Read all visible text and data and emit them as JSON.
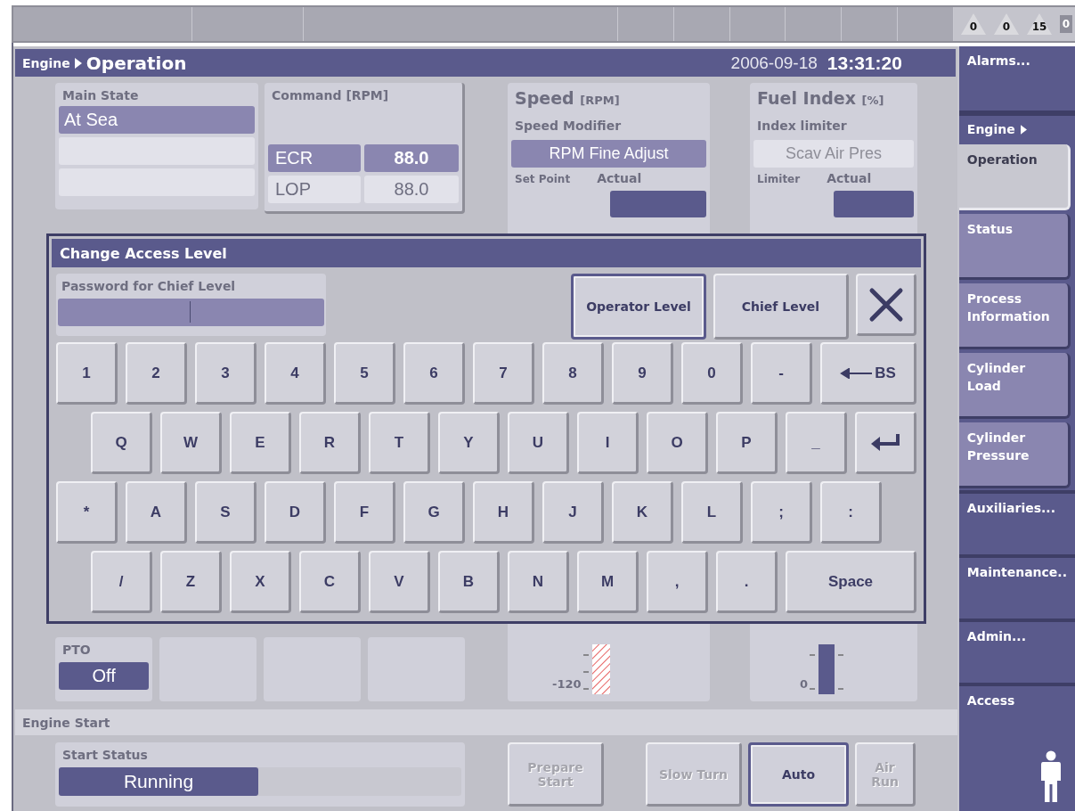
{
  "top_bar": {
    "alarm_counters": [
      {
        "kind": "triangle",
        "count": "0"
      },
      {
        "kind": "triangle",
        "count": "0"
      },
      {
        "kind": "triangle",
        "count": "15"
      },
      {
        "kind": "box",
        "count": "0"
      }
    ]
  },
  "header": {
    "path": "Engine",
    "title": "Operation",
    "date": "2006-09-18",
    "time": "13:31:20"
  },
  "main_state": {
    "label": "Main State",
    "states": [
      {
        "label": "At Sea",
        "selected": true
      }
    ]
  },
  "command": {
    "label": "Command [RPM]",
    "rows": [
      {
        "source": "ECR",
        "value": "88.0",
        "selected": true
      },
      {
        "source": "LOP",
        "value": "88.0",
        "selected": false
      }
    ]
  },
  "speed": {
    "title": "Speed",
    "unit": "[RPM]",
    "modifier_label": "Speed Modifier",
    "modifier": "RPM Fine Adjust",
    "set_point_label": "Set Point",
    "actual_label": "Actual",
    "scale_tick": "-120"
  },
  "fuel_index": {
    "title": "Fuel Index",
    "unit": "[%]",
    "limiter_label": "Index limiter",
    "limiter": "Scav Air Pres",
    "limiter_column": "Limiter",
    "actual_label": "Actual",
    "scale_tick": "0"
  },
  "pto": {
    "label": "PTO",
    "value": "Off"
  },
  "engine_start": {
    "title": "Engine Start",
    "status_label": "Start Status",
    "status": "Running",
    "buttons": [
      {
        "label": "Prepare Start",
        "disabled": true,
        "selected": false
      },
      {
        "label": "Slow Turn",
        "disabled": true,
        "selected": false
      },
      {
        "label": "Auto",
        "disabled": false,
        "selected": true
      },
      {
        "label": "Air Run",
        "disabled": true,
        "selected": false
      }
    ]
  },
  "sidebar": {
    "items": [
      {
        "kind": "menu",
        "label": "Alarms..."
      },
      {
        "kind": "heading",
        "label": "Engine"
      },
      {
        "kind": "tab",
        "label": "Operation",
        "selected": true
      },
      {
        "kind": "tab",
        "label": "Status",
        "selected": false
      },
      {
        "kind": "tab",
        "label": "Process Information",
        "selected": false
      },
      {
        "kind": "tab",
        "label": "Cylinder Load",
        "selected": false
      },
      {
        "kind": "tab",
        "label": "Cylinder Pressure",
        "selected": false
      },
      {
        "kind": "menu",
        "label": "Auxiliaries..."
      },
      {
        "kind": "menu",
        "label": "Maintenance.."
      },
      {
        "kind": "menu",
        "label": "Admin..."
      },
      {
        "kind": "access",
        "label": "Access"
      }
    ]
  },
  "dialog": {
    "title": "Change Access Level",
    "password_label": "Password for Chief Level",
    "levels": [
      {
        "label": "Operator Level",
        "selected": true
      },
      {
        "label": "Chief Level",
        "selected": false
      }
    ],
    "keyboard": [
      [
        {
          "kind": "char",
          "label": "1"
        },
        {
          "kind": "char",
          "label": "2"
        },
        {
          "kind": "char",
          "label": "3"
        },
        {
          "kind": "char",
          "label": "4"
        },
        {
          "kind": "char",
          "label": "5"
        },
        {
          "kind": "char",
          "label": "6"
        },
        {
          "kind": "char",
          "label": "7"
        },
        {
          "kind": "char",
          "label": "8"
        },
        {
          "kind": "char",
          "label": "9"
        },
        {
          "kind": "char",
          "label": "0"
        },
        {
          "kind": "char",
          "label": "-"
        },
        {
          "kind": "backspace",
          "label": "BS"
        }
      ],
      [
        {
          "kind": "char",
          "label": "Q"
        },
        {
          "kind": "char",
          "label": "W"
        },
        {
          "kind": "char",
          "label": "E"
        },
        {
          "kind": "char",
          "label": "R"
        },
        {
          "kind": "char",
          "label": "T"
        },
        {
          "kind": "char",
          "label": "Y"
        },
        {
          "kind": "char",
          "label": "U"
        },
        {
          "kind": "char",
          "label": "I"
        },
        {
          "kind": "char",
          "label": "O"
        },
        {
          "kind": "char",
          "label": "P"
        },
        {
          "kind": "char",
          "label": "_"
        },
        {
          "kind": "enter"
        }
      ],
      [
        {
          "kind": "char",
          "label": "*"
        },
        {
          "kind": "char",
          "label": "A"
        },
        {
          "kind": "char",
          "label": "S"
        },
        {
          "kind": "char",
          "label": "D"
        },
        {
          "kind": "char",
          "label": "F"
        },
        {
          "kind": "char",
          "label": "G"
        },
        {
          "kind": "char",
          "label": "H"
        },
        {
          "kind": "char",
          "label": "J"
        },
        {
          "kind": "char",
          "label": "K"
        },
        {
          "kind": "char",
          "label": "L"
        },
        {
          "kind": "char",
          "label": ";"
        },
        {
          "kind": "char",
          "label": ":"
        }
      ],
      [
        {
          "kind": "char",
          "label": "/"
        },
        {
          "kind": "char",
          "label": "Z"
        },
        {
          "kind": "char",
          "label": "X"
        },
        {
          "kind": "char",
          "label": "C"
        },
        {
          "kind": "char",
          "label": "V"
        },
        {
          "kind": "char",
          "label": "B"
        },
        {
          "kind": "char",
          "label": "N"
        },
        {
          "kind": "char",
          "label": "M"
        },
        {
          "kind": "char",
          "label": ","
        },
        {
          "kind": "char",
          "label": "."
        },
        {
          "kind": "space",
          "label": "Space"
        }
      ]
    ]
  }
}
